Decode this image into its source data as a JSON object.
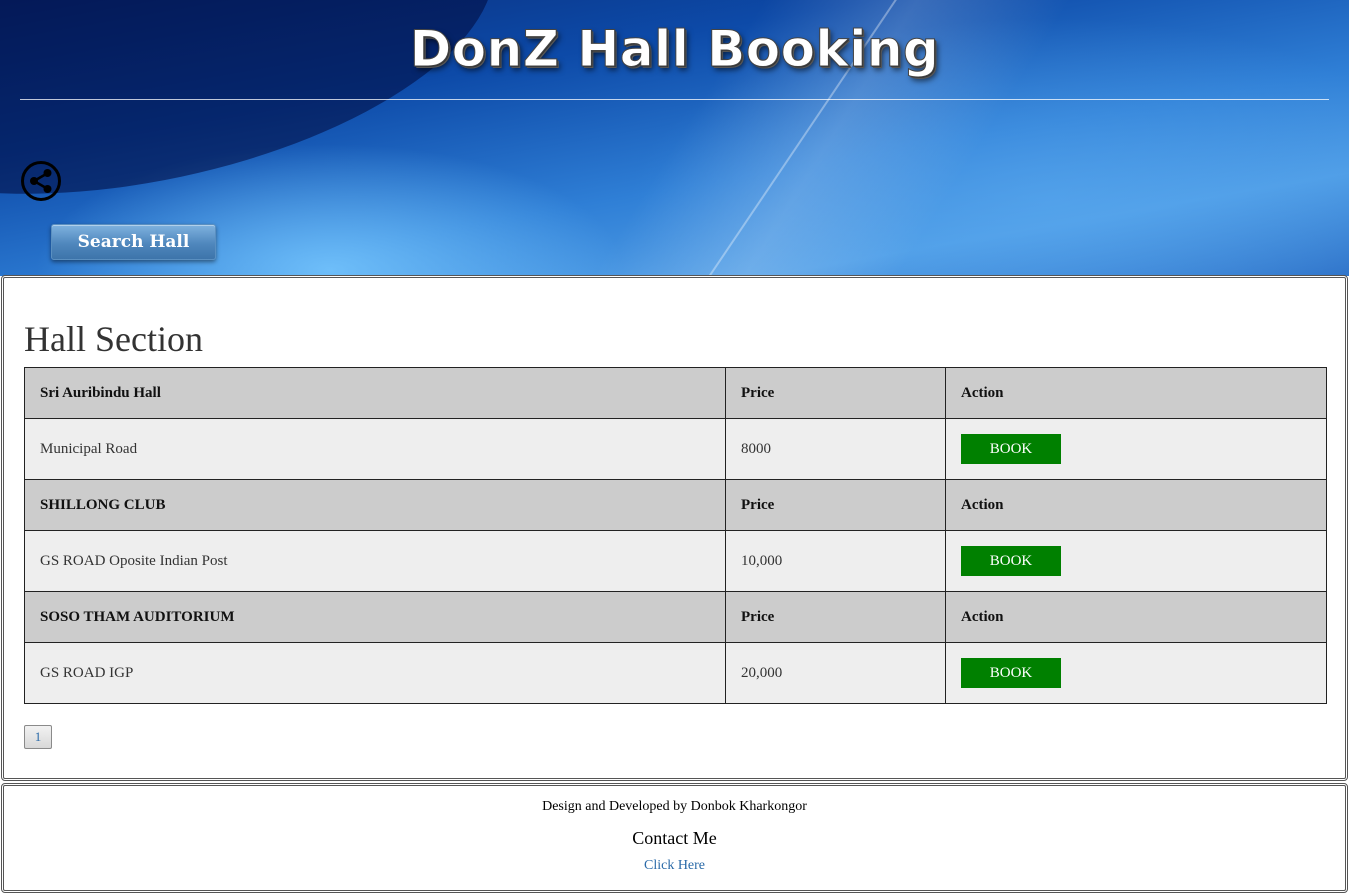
{
  "header": {
    "title": "DonZ Hall Booking",
    "share_icon": "share-icon",
    "search_button_label": "Search Hall"
  },
  "main": {
    "section_title": "Hall Section",
    "halls": [
      {
        "name": "Sri Auribindu Hall",
        "price_header": "Price",
        "action_header": "Action",
        "address": "Municipal Road",
        "price": "8000",
        "book_label": "BOOK"
      },
      {
        "name": "SHILLONG CLUB",
        "price_header": "Price",
        "action_header": "Action",
        "address": "GS ROAD Oposite Indian Post",
        "price": "10,000",
        "book_label": "BOOK"
      },
      {
        "name": "SOSO THAM AUDITORIUM",
        "price_header": "Price",
        "action_header": "Action",
        "address": "GS ROAD IGP",
        "price": "20,000",
        "book_label": "BOOK"
      }
    ],
    "pagination": {
      "current_page": "1"
    }
  },
  "footer": {
    "credit": "Design and Developed by Donbok Kharkongor",
    "contact_heading": "Contact Me",
    "contact_link": "Click Here"
  },
  "colors": {
    "book_button": "#008000",
    "hall_header_row": "#cccccc",
    "hall_detail_row": "#eeeeee",
    "link": "#2a6aa8"
  }
}
